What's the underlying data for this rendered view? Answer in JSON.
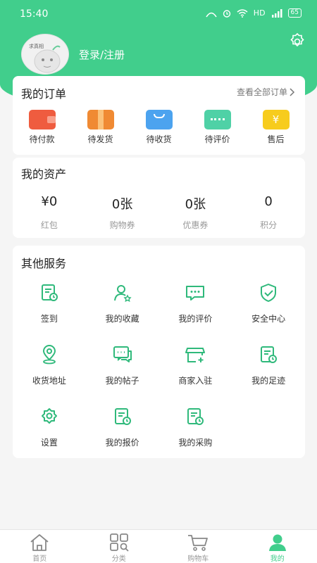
{
  "status_bar": {
    "time": "15:40",
    "network": "HD",
    "battery": "65"
  },
  "profile": {
    "avatar_text": "求真相",
    "login_label": "登录/注册"
  },
  "orders": {
    "title": "我的订单",
    "view_all": "查看全部订单",
    "items": [
      {
        "label": "待付款",
        "icon": "wallet-icon",
        "color": "#ef5c3f"
      },
      {
        "label": "待发货",
        "icon": "package-icon",
        "color": "#f08a33"
      },
      {
        "label": "待收货",
        "icon": "box-icon",
        "color": "#4ca3ef"
      },
      {
        "label": "待评价",
        "icon": "comment-icon",
        "color": "#4fd1a6"
      },
      {
        "label": "售后",
        "icon": "yen-bag-icon",
        "color": "#f7cc1d"
      }
    ]
  },
  "assets": {
    "title": "我的资产",
    "items": [
      {
        "value": "¥0",
        "label": "红包"
      },
      {
        "value": "0张",
        "label": "购物券"
      },
      {
        "value": "0张",
        "label": "优惠券"
      },
      {
        "value": "0",
        "label": "积分"
      }
    ]
  },
  "services": {
    "title": "其他服务",
    "items": [
      {
        "label": "签到",
        "icon": "checkin-icon"
      },
      {
        "label": "我的收藏",
        "icon": "favorite-user-icon"
      },
      {
        "label": "我的评价",
        "icon": "review-icon"
      },
      {
        "label": "安全中心",
        "icon": "shield-icon"
      },
      {
        "label": "收货地址",
        "icon": "location-icon"
      },
      {
        "label": "我的帖子",
        "icon": "posts-icon"
      },
      {
        "label": "商家入驻",
        "icon": "store-icon"
      },
      {
        "label": "我的足迹",
        "icon": "history-icon"
      },
      {
        "label": "设置",
        "icon": "gear-icon"
      },
      {
        "label": "我的报价",
        "icon": "quote-icon"
      },
      {
        "label": "我的采购",
        "icon": "purchase-icon"
      }
    ]
  },
  "tabbar": {
    "items": [
      {
        "label": "首页",
        "icon": "home-icon",
        "active": false
      },
      {
        "label": "分类",
        "icon": "category-icon",
        "active": false
      },
      {
        "label": "购物车",
        "icon": "cart-icon",
        "active": false
      },
      {
        "label": "我的",
        "icon": "profile-icon",
        "active": true
      }
    ]
  },
  "colors": {
    "accent": "#41ce8c",
    "icon_green": "#2fb97b"
  }
}
